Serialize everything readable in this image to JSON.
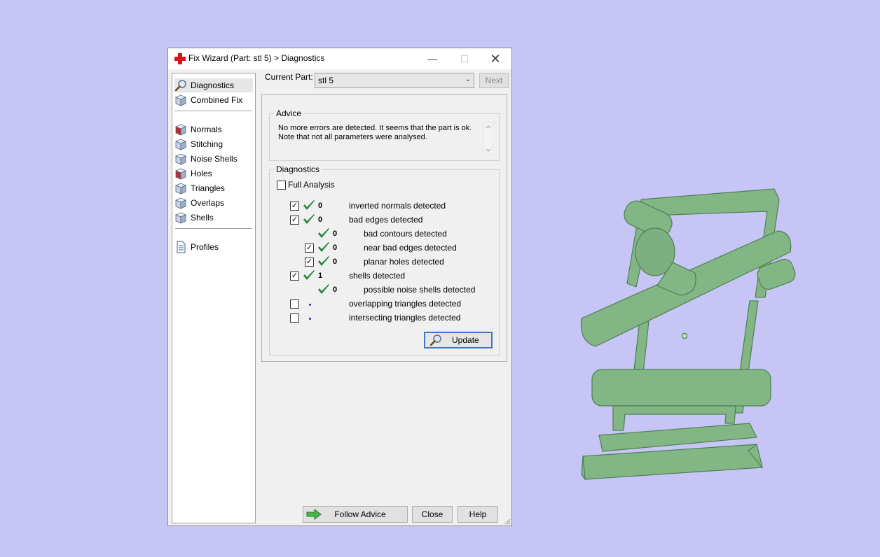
{
  "window": {
    "title": "Fix Wizard (Part: stl 5) > Diagnostics",
    "controls": {
      "minimize": "—",
      "maximize": "☐",
      "close": "✕"
    }
  },
  "nav": {
    "items": [
      {
        "label": "Diagnostics",
        "icon": "magnifier-icon",
        "selected": true
      },
      {
        "label": "Combined Fix",
        "icon": "cube-icon"
      },
      {
        "label": "Normals",
        "icon": "normals-cube-icon"
      },
      {
        "label": "Stitching",
        "icon": "stitching-cube-icon"
      },
      {
        "label": "Noise Shells",
        "icon": "noise-shells-icon"
      },
      {
        "label": "Holes",
        "icon": "holes-cube-icon"
      },
      {
        "label": "Triangles",
        "icon": "triangles-cube-icon"
      },
      {
        "label": "Overlaps",
        "icon": "overlaps-cube-icon"
      },
      {
        "label": "Shells",
        "icon": "shells-cube-icon"
      },
      {
        "label": "Profiles",
        "icon": "document-icon"
      }
    ]
  },
  "current_part": {
    "label": "Current Part:",
    "value": "stl 5",
    "next_label": "Next"
  },
  "advice": {
    "title": "Advice",
    "line1": "No more errors are detected. It seems that the part is ok.",
    "line2": "Note that not all parameters were analysed."
  },
  "diagnostics": {
    "title": "Diagnostics",
    "full_analysis_label": "Full Analysis",
    "full_analysis_checked": false,
    "rows": [
      {
        "checkbox": true,
        "checked": true,
        "status": "ok",
        "count": "0",
        "label": "inverted normals detected",
        "indent": 0
      },
      {
        "checkbox": true,
        "checked": true,
        "status": "ok",
        "count": "0",
        "label": "bad edges detected",
        "indent": 0
      },
      {
        "checkbox": false,
        "checked": false,
        "status": "ok",
        "count": "0",
        "label": "bad contours detected",
        "indent": 1
      },
      {
        "checkbox": true,
        "checked": true,
        "status": "ok",
        "count": "0",
        "label": "near bad edges detected",
        "indent": 1
      },
      {
        "checkbox": true,
        "checked": true,
        "status": "ok",
        "count": "0",
        "label": "planar holes detected",
        "indent": 1
      },
      {
        "checkbox": true,
        "checked": true,
        "status": "ok",
        "count": "1",
        "label": "shells detected",
        "indent": 0
      },
      {
        "checkbox": false,
        "checked": false,
        "status": "ok",
        "count": "0",
        "label": "possible noise shells detected",
        "indent": 1
      },
      {
        "checkbox": true,
        "checked": false,
        "status": "none",
        "count": "",
        "label": "overlapping triangles detected",
        "indent": 0
      },
      {
        "checkbox": true,
        "checked": false,
        "status": "none",
        "count": "",
        "label": "intersecting triangles detected",
        "indent": 0
      }
    ],
    "update_label": "Update"
  },
  "footer": {
    "follow_advice": "Follow Advice",
    "close": "Close",
    "help": "Help"
  },
  "colors": {
    "background": "#c6c5f5",
    "model": "#82b785",
    "tick": "#1f8a3c"
  }
}
